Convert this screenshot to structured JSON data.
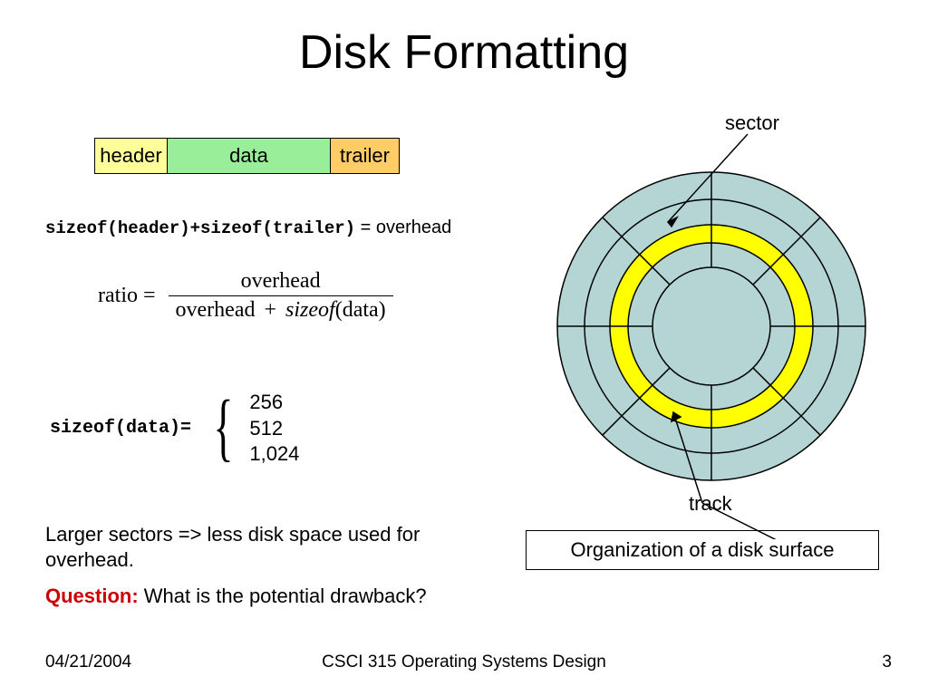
{
  "title": "Disk Formatting",
  "block": {
    "header": "header",
    "data": "data",
    "trailer": "trailer"
  },
  "overhead": {
    "mono": "sizeof(header)+sizeof(trailer)",
    "eq": " = overhead"
  },
  "ratio": {
    "lhs": "ratio",
    "eq": "=",
    "num": "overhead",
    "den_overhead": "overhead",
    "plus": "+",
    "sizeof": "sizeof",
    "arg": "(data)"
  },
  "sizeof_data": {
    "label": "sizeof(data)=",
    "sizes": [
      "256",
      "512",
      "1,024"
    ]
  },
  "larger": "Larger sectors => less disk space used for overhead.",
  "question": {
    "q": "Question:",
    "text": " What is the potential drawback?"
  },
  "disk": {
    "sector_label": "sector",
    "track_label": "track",
    "caption": "Organization of a disk surface"
  },
  "footer": {
    "date": "04/21/2004",
    "course": "CSCI 315 Operating Systems Design",
    "page": "3"
  }
}
